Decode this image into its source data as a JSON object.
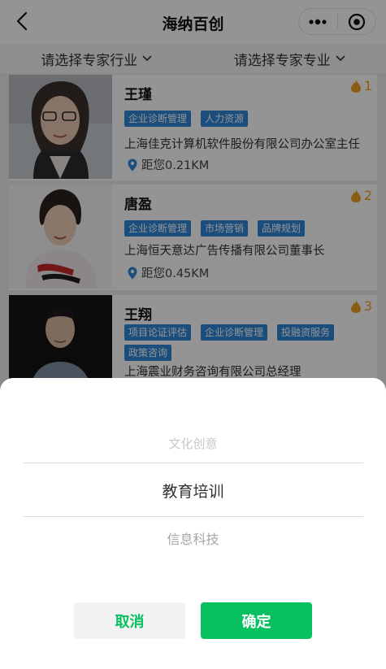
{
  "nav": {
    "title": "海纳百创",
    "back_icon": "chevron-left-icon",
    "more_icon": "more-dots-icon",
    "close_icon": "target-icon"
  },
  "filters": [
    {
      "label": "请选择专家行业",
      "icon": "chevron-down-icon"
    },
    {
      "label": "请选择专家专业",
      "icon": "chevron-down-icon"
    }
  ],
  "experts": [
    {
      "name": "王瑾",
      "rank": "1",
      "tags": [
        "企业诊断管理",
        "人力资源"
      ],
      "company": "上海佳克计算机软件股份有限公司办公室主任",
      "distance": "距您0.21KM"
    },
    {
      "name": "唐盈",
      "rank": "2",
      "tags": [
        "企业诊断管理",
        "市场营销",
        "品牌规划"
      ],
      "company": "上海恒天意达广告传播有限公司董事长",
      "distance": "距您0.45KM"
    },
    {
      "name": "王翔",
      "rank": "3",
      "tags": [
        "项目论证评估",
        "企业诊断管理",
        "投融资服务",
        "政策咨询"
      ],
      "company": "上海震业财务咨询有限公司总经理",
      "distance": ""
    }
  ],
  "picker": {
    "options": [
      "文化创意",
      "教育培训",
      "信息科技"
    ],
    "selected": "教育培训",
    "cancel_label": "取消",
    "confirm_label": "确定"
  },
  "colors": {
    "accent": "#07c160",
    "tag": "#2f86d8",
    "rank": "#f0a020"
  }
}
